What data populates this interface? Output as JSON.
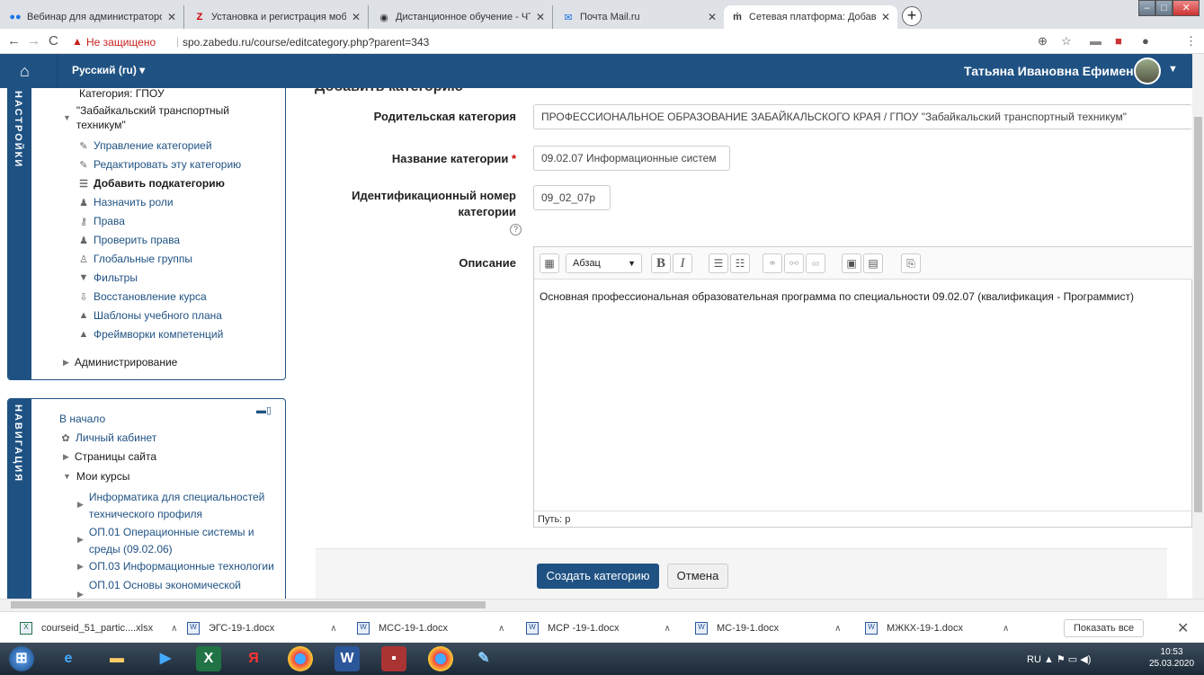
{
  "browser": {
    "tabs": [
      {
        "label": "Вебинар для администраторов",
        "icon": "dots-icon"
      },
      {
        "label": "Установка и регистрация моби",
        "icon": "z-icon"
      },
      {
        "label": "Дистанционное обучение - ЧТС",
        "icon": "globe-icon"
      },
      {
        "label": "Почта Mail.ru",
        "icon": "mail-icon"
      },
      {
        "label": "Сетевая платформа: Добавить",
        "icon": "moodle-icon"
      }
    ],
    "security_warning": "Не защищено",
    "url": "spo.zabedu.ru/course/editcategory.php?parent=343"
  },
  "navbar": {
    "language": "Русский (ru) ▾",
    "user_name": "Татьяна Ивановна Ефименко"
  },
  "settings_block": {
    "title": "НАСТРОЙКИ",
    "cut_item": "Категория: ГПОУ",
    "category": "\"Забайкальский транспортный техникум\"",
    "items": [
      {
        "label": "Управление категорией",
        "icon": "pencil-icon"
      },
      {
        "label": "Редактировать эту категорию",
        "icon": "pencil-icon"
      },
      {
        "label": "Добавить подкатегорию",
        "icon": "list-icon"
      },
      {
        "label": "Назначить роли",
        "icon": "user-icon"
      },
      {
        "label": "Права",
        "icon": "key-icon"
      },
      {
        "label": "Проверить права",
        "icon": "user-icon"
      },
      {
        "label": "Глобальные группы",
        "icon": "group-icon"
      },
      {
        "label": "Фильтры",
        "icon": "filter-icon"
      },
      {
        "label": "Восстановление курса",
        "icon": "restore-icon"
      },
      {
        "label": "Шаблоны учебного плана",
        "icon": "template-icon"
      },
      {
        "label": "Фреймворки компетенций",
        "icon": "template-icon"
      }
    ],
    "admin": "Администрирование"
  },
  "nav_block": {
    "title": "НАВИГАЦИЯ",
    "home": "В начало",
    "dashboard": "Личный кабинет",
    "site_pages": "Страницы сайта",
    "my_courses": "Мои курсы",
    "courses": [
      {
        "line1": "Информатика для специальностей",
        "line2": "технического профиля"
      },
      {
        "line1": "ОП.01 Операционные системы и",
        "line2": "среды (09.02.06)"
      },
      {
        "line1": "ОП.03 Информационные технологии",
        "line2": ""
      },
      {
        "line1": "ОП.01 Основы экономической",
        "line2": ""
      }
    ]
  },
  "form": {
    "heading": "Добавить категорию",
    "parent_label": "Родительская категория",
    "parent_value": "ПРОФЕССИОНАЛЬНОЕ ОБРАЗОВАНИЕ ЗАБАЙКАЛЬСКОГО КРАЯ / ГПОУ \"Забайкальский транспортный техникум\"",
    "name_label": "Название категории",
    "required_mark": "*",
    "name_value": "09.02.07 Информационные систем",
    "id_label_line1": "Идентификационный номер",
    "id_label_line2": "категории",
    "id_value": "09_02_07р",
    "desc_label": "Описание",
    "format_select": "Абзац",
    "desc_text": "Основная профессиональная образовательная программа по специальности 09.02.07 (квалификация - Программист)",
    "path": "Путь: p",
    "submit": "Создать категорию",
    "cancel": "Отмена"
  },
  "downloads": {
    "files": [
      "courseid_51_partic....xlsx",
      "ЭГС-19-1.docx",
      "МСС-19-1.docx",
      "МСР -19-1.docx",
      "МС-19-1.docx",
      "МЖКХ-19-1.docx"
    ],
    "show_all": "Показать все"
  },
  "taskbar": {
    "lang": "RU",
    "time": "10:53",
    "date": "25.03.2020"
  }
}
